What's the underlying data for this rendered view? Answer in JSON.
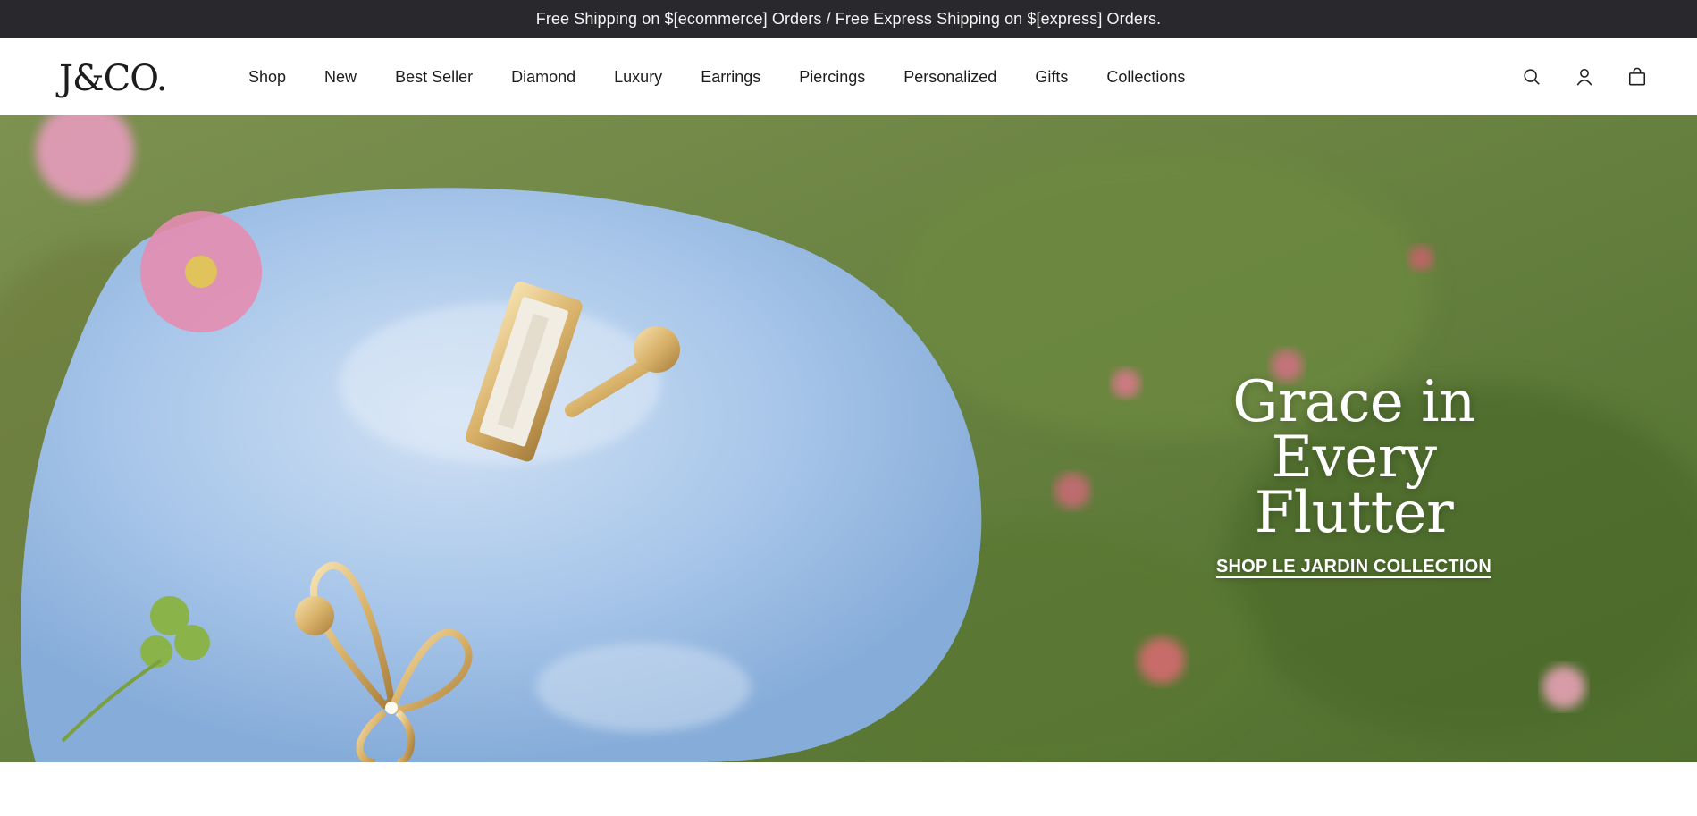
{
  "announcement": {
    "text": "Free Shipping on $[ecommerce] Orders / Free Express Shipping on $[express] Orders."
  },
  "header": {
    "logo": "J&CO.",
    "nav": [
      {
        "label": "Shop"
      },
      {
        "label": "New"
      },
      {
        "label": "Best Seller"
      },
      {
        "label": "Diamond"
      },
      {
        "label": "Luxury"
      },
      {
        "label": "Earrings"
      },
      {
        "label": "Piercings"
      },
      {
        "label": "Personalized"
      },
      {
        "label": "Gifts"
      },
      {
        "label": "Collections"
      }
    ],
    "icons": [
      "search-icon",
      "user-icon",
      "bag-icon"
    ]
  },
  "hero": {
    "title_line1": "Grace in",
    "title_line2": "Every Flutter",
    "cta": "SHOP LE JARDIN COLLECTION"
  },
  "colors": {
    "announcement_bg": "#29282d",
    "text": "#1d1d1f",
    "hero_text": "#ffffff"
  }
}
